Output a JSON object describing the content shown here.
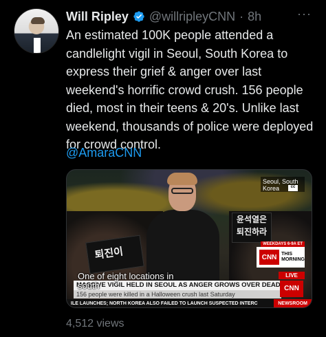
{
  "tweet": {
    "author_name": "Will Ripley",
    "handle": "@willripleyCNN",
    "time": "8h",
    "more_glyph": "···",
    "text": "An estimated 100K people attended a candlelight vigil in Seoul, South Korea to express their grief & anger over last weekend's horrific crowd crush. 156 people died, most in their teens & 20's. Unlike last weekend, thousands of police were deployed for crowd control.",
    "mention": "@AmaraCNN",
    "views": "4,512 views"
  },
  "media": {
    "location_badge": "Seoul, South Korea",
    "cc_label": "cc",
    "sign_left": "퇴진이",
    "sign_right_line1": "윤석열은",
    "sign_right_line2": "퇴진하라",
    "weekday_label": "WEEKDAYS 6-9A ET",
    "cnn_logo": "CNN",
    "show_line1": "THIS",
    "show_line2": "MORNING",
    "caption": "One of eight locations in south",
    "live_label": "LIVE",
    "headline": "MASSIVE VIGIL HELD IN SEOUL AS ANGER GROWS OVER DEADLY CROWD CRUSH",
    "subhead": "156 people were killed in a Halloween crush last Saturday",
    "ticker": "ILE LAUNCHES; NORTH KOREA ALSO FAILED TO LAUNCH SUSPECTED INTERC",
    "newsroom": "NEWSROOM"
  },
  "colors": {
    "background": "#000000",
    "text": "#e7e9ea",
    "muted": "#71767b",
    "link": "#1d9bf0",
    "verified": "#1d9bf0",
    "cnn_red": "#cc0000"
  },
  "icons": {
    "verified": "verified-badge-icon",
    "more": "more-options-icon"
  }
}
